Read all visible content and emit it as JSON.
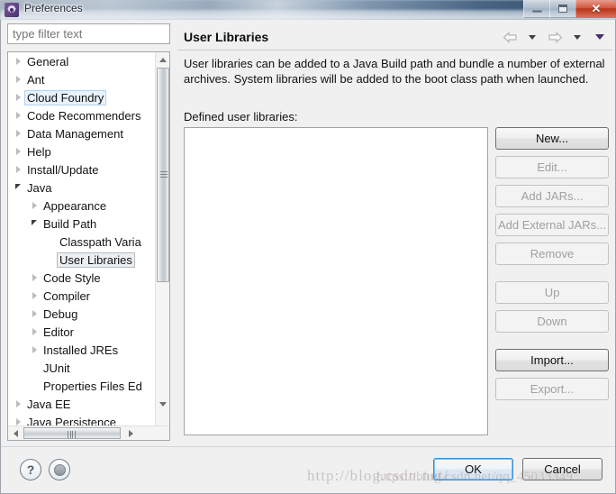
{
  "window": {
    "title": "Preferences",
    "icon": "gear-icon",
    "controls": {
      "minimize": "Minimize",
      "maximize": "Maximize",
      "close": "Close",
      "close_glyph": "✕"
    }
  },
  "left_pane": {
    "filter": {
      "value": "",
      "placeholder": "type filter text"
    },
    "tree": [
      {
        "label": "General",
        "depth": 0,
        "state": "collapsed",
        "selected": "none"
      },
      {
        "label": "Ant",
        "depth": 0,
        "state": "collapsed",
        "selected": "none"
      },
      {
        "label": "Cloud Foundry",
        "depth": 0,
        "state": "collapsed",
        "selected": "blue"
      },
      {
        "label": "Code Recommenders",
        "depth": 0,
        "state": "collapsed",
        "selected": "none"
      },
      {
        "label": "Data Management",
        "depth": 0,
        "state": "collapsed",
        "selected": "none"
      },
      {
        "label": "Help",
        "depth": 0,
        "state": "collapsed",
        "selected": "none"
      },
      {
        "label": "Install/Update",
        "depth": 0,
        "state": "collapsed",
        "selected": "none"
      },
      {
        "label": "Java",
        "depth": 0,
        "state": "expanded",
        "selected": "none"
      },
      {
        "label": "Appearance",
        "depth": 1,
        "state": "collapsed",
        "selected": "none"
      },
      {
        "label": "Build Path",
        "depth": 1,
        "state": "expanded",
        "selected": "none"
      },
      {
        "label": "Classpath Varia",
        "depth": 2,
        "state": "leaf",
        "selected": "none"
      },
      {
        "label": "User Libraries",
        "depth": 2,
        "state": "leaf",
        "selected": "gray"
      },
      {
        "label": "Code Style",
        "depth": 1,
        "state": "collapsed",
        "selected": "none"
      },
      {
        "label": "Compiler",
        "depth": 1,
        "state": "collapsed",
        "selected": "none"
      },
      {
        "label": "Debug",
        "depth": 1,
        "state": "collapsed",
        "selected": "none"
      },
      {
        "label": "Editor",
        "depth": 1,
        "state": "collapsed",
        "selected": "none"
      },
      {
        "label": "Installed JREs",
        "depth": 1,
        "state": "collapsed",
        "selected": "none"
      },
      {
        "label": "JUnit",
        "depth": 1,
        "state": "leaf",
        "selected": "none"
      },
      {
        "label": "Properties Files Ed",
        "depth": 1,
        "state": "leaf",
        "selected": "none"
      },
      {
        "label": "Java EE",
        "depth": 0,
        "state": "collapsed",
        "selected": "none"
      },
      {
        "label": "Java Persistence",
        "depth": 0,
        "state": "collapsed",
        "selected": "none"
      }
    ],
    "scrollbars": {
      "vertical_up": "scroll-up",
      "vertical_down": "scroll-down",
      "horizontal_left": "scroll-left",
      "horizontal_right": "scroll-right"
    }
  },
  "right_pane": {
    "title": "User Libraries",
    "nav": {
      "back": "back-arrow",
      "back_menu": "back-dropdown",
      "forward": "forward-arrow",
      "forward_menu": "forward-dropdown",
      "view_menu": "view-menu"
    },
    "description": "User libraries can be added to a Java Build path and bundle a number of external archives. System libraries will be added to the boot class path when launched.",
    "list_label": "Defined user libraries:",
    "list_items": [],
    "buttons": [
      {
        "label": "New...",
        "enabled": true,
        "gap": "sm"
      },
      {
        "label": "Edit...",
        "enabled": false,
        "gap": "sm"
      },
      {
        "label": "Add JARs...",
        "enabled": false,
        "gap": "sm"
      },
      {
        "label": "Add External JARs...",
        "enabled": false,
        "gap": "sm"
      },
      {
        "label": "Remove",
        "enabled": false,
        "gap": "md"
      },
      {
        "label": "Up",
        "enabled": false,
        "gap": "sm"
      },
      {
        "label": "Down",
        "enabled": false,
        "gap": "md"
      },
      {
        "label": "Import...",
        "enabled": true,
        "gap": "sm"
      },
      {
        "label": "Export...",
        "enabled": false,
        "gap": "sm"
      }
    ]
  },
  "footer": {
    "help_icon": "question-mark-icon",
    "apply_icon": "apply-icon",
    "ok_label": "OK",
    "cancel_label": "Cancel"
  },
  "watermarks": {
    "line1": "http://blog.csdn.net/",
    "line2": "https://blog.csdn.net/qq_45033349"
  },
  "colors": {
    "accent_focus": "#3c8fd4",
    "close_red": "#b8341c",
    "selection_blue": "#e8f2fb",
    "dialog_bg": "#f0f0f0",
    "disabled_text": "#a0a0a0"
  }
}
